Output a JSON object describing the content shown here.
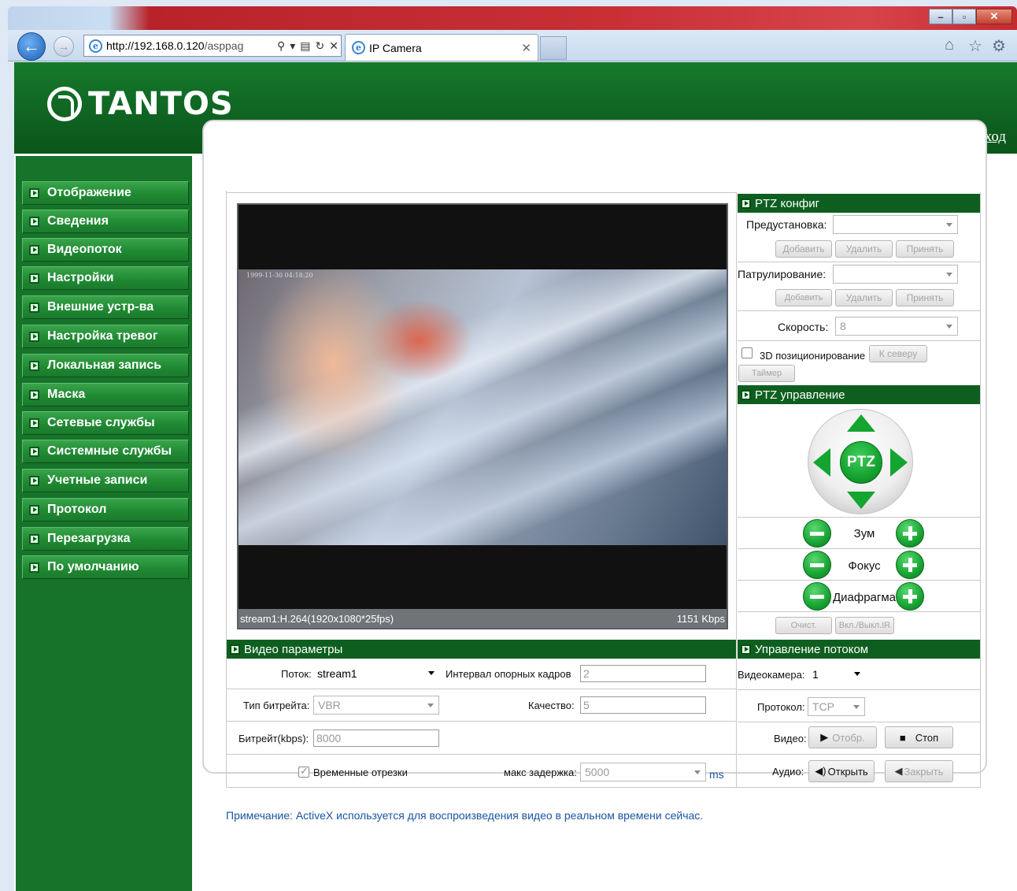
{
  "browser": {
    "address": {
      "host": "http://192.168.0.120",
      "rest": "/asppag"
    },
    "tab_title": "IP Camera"
  },
  "header": {
    "logo_text": "TANTOS",
    "logout": "Выход"
  },
  "sidebar": {
    "items": [
      {
        "label": "Отображение"
      },
      {
        "label": "Сведения"
      },
      {
        "label": "Видеопоток"
      },
      {
        "label": "Настройки"
      },
      {
        "label": "Внешние устр-ва"
      },
      {
        "label": "Настройка тревог"
      },
      {
        "label": "Локальная запись"
      },
      {
        "label": "Маска"
      },
      {
        "label": "Сетевые службы"
      },
      {
        "label": "Системные службы"
      },
      {
        "label": "Учетные записи"
      },
      {
        "label": "Протокол"
      },
      {
        "label": "Перезагрузка"
      },
      {
        "label": "По умолчанию"
      }
    ]
  },
  "video": {
    "osd": "1999-11-30 04:18:20",
    "status_left": "stream1:H.264(1920x1080*25fps)",
    "status_right": "1151 Kbps"
  },
  "ptz_config": {
    "title": "PTZ конфиг",
    "preset_label": "Предустановка:",
    "patrol_label": "Патрулирование:",
    "speed_label": "Скорость:",
    "speed_value": "8",
    "add": "Добавить",
    "delete": "Удалить",
    "apply": "Принять",
    "pos3d_label": "3D позиционирование",
    "north": "К северу",
    "timer": "Таймер"
  },
  "ptz_control": {
    "title": "PTZ управление",
    "joystick": "PTZ",
    "zoom": "Зум",
    "focus": "Фокус",
    "iris": "Диафрагма",
    "clear": "Очист.",
    "ir_toggle": "Вкл./Выкл.IR"
  },
  "video_params": {
    "title": "Видео параметры",
    "stream_label": "Поток:",
    "stream_value": "stream1",
    "gop_label": "Интервал опорных кадров",
    "gop_value": "2",
    "bitrate_type_label": "Тип битрейта:",
    "bitrate_type_value": "VBR",
    "quality_label": "Качество:",
    "quality_value": "5",
    "bitrate_label": "Битрейт(kbps):",
    "bitrate_value": "8000",
    "timestamps_label": "Временные отрезки",
    "maxdelay_label": "макс задержка:",
    "maxdelay_value": "5000",
    "maxdelay_unit": "ms"
  },
  "stream_control": {
    "title": "Управление потоком",
    "camera_label": "Видеокамера:",
    "camera_value": "1",
    "protocol_label": "Протокол:",
    "protocol_value": "TCP",
    "video_label": "Видео:",
    "video_play": "Отобр.",
    "video_stop": "Стоп",
    "audio_label": "Аудио:",
    "audio_open": "Открыть",
    "audio_close": "Закрыть"
  },
  "note": "Примечание: ActiveX используется для воспроизведения видео в реальном времени сейчас.",
  "colors": {
    "brand_green": "#0e5f1f",
    "menu_green": "#208a33",
    "note_blue": "#1b55a3"
  }
}
